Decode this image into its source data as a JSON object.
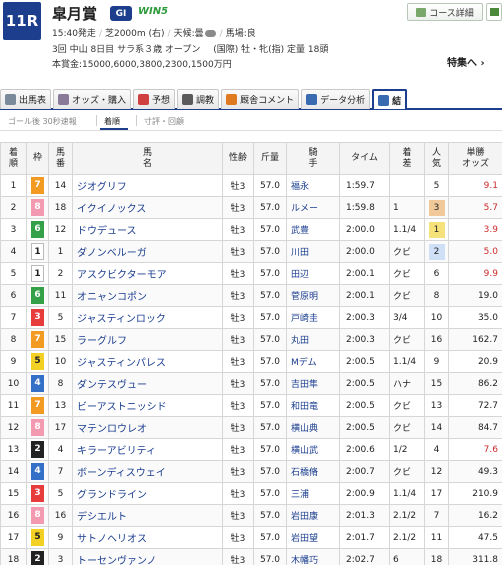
{
  "header": {
    "race_no": "11R",
    "race_name": "皐月賞",
    "grade": "GI",
    "win5": "WIN5",
    "start_time": "15:40発走",
    "course": "芝2000m (右)",
    "weather_label": "天候:曇",
    "track_label": "馬場:良",
    "meeting": "3回 中山 8日目",
    "class": "サラ系３歳 オープン",
    "conditions": "(国際) 牡・牝(指) 定量 18頭",
    "prize": "本賞金:15000,6000,3800,2300,1500万円",
    "course_button": "コース詳細",
    "special": "特集へ ›"
  },
  "tabs": [
    {
      "label": "出馬表",
      "icon": "table-icon",
      "color": "#7a8a9a"
    },
    {
      "label": "オッズ・購入",
      "icon": "ticket-icon",
      "color": "#8a7a9a"
    },
    {
      "label": "予想",
      "icon": "target-icon",
      "color": "#d04040"
    },
    {
      "label": "調教",
      "icon": "stopwatch-icon",
      "color": "#5a5a5a"
    },
    {
      "label": "厩舎コメント",
      "icon": "stable-icon",
      "color": "#e07a20"
    },
    {
      "label": "データ分析",
      "icon": "chart-icon",
      "color": "#3a6ab0"
    },
    {
      "label": "結",
      "icon": "result-icon",
      "color": "#3a6ab0"
    }
  ],
  "subtabs": {
    "first": "ゴール後 30秒速報",
    "active": "着順",
    "third": "寸評・回顧"
  },
  "columns": [
    "着順",
    "枠",
    "馬番",
    "馬名",
    "性齢",
    "斤量",
    "騎手",
    "タイム",
    "着差",
    "人気",
    "単勝オッズ"
  ],
  "rows": [
    {
      "pos": "1",
      "waku": "7",
      "uma": "14",
      "name": "ジオグリフ",
      "sex": "牡3",
      "kin": "57.0",
      "jockey": "福永",
      "time": "1:59.7",
      "margin": "",
      "pop": "5",
      "odds": "9.1"
    },
    {
      "pos": "2",
      "waku": "8",
      "uma": "18",
      "name": "イクイノックス",
      "sex": "牡3",
      "kin": "57.0",
      "jockey": "ルメー",
      "time": "1:59.8",
      "margin": "1",
      "pop": "3",
      "odds": "5.7"
    },
    {
      "pos": "3",
      "waku": "6",
      "uma": "12",
      "name": "ドウデュース",
      "sex": "牡3",
      "kin": "57.0",
      "jockey": "武豊",
      "time": "2:00.0",
      "margin": "1.1/4",
      "pop": "1",
      "odds": "3.9"
    },
    {
      "pos": "4",
      "waku": "1",
      "uma": "1",
      "name": "ダノンベルーガ",
      "sex": "牡3",
      "kin": "57.0",
      "jockey": "川田",
      "time": "2:00.0",
      "margin": "クビ",
      "pop": "2",
      "odds": "5.0"
    },
    {
      "pos": "5",
      "waku": "1",
      "uma": "2",
      "name": "アスクビクターモア",
      "sex": "牡3",
      "kin": "57.0",
      "jockey": "田辺",
      "time": "2:00.1",
      "margin": "クビ",
      "pop": "6",
      "odds": "9.9"
    },
    {
      "pos": "6",
      "waku": "6",
      "uma": "11",
      "name": "オニャンコポン",
      "sex": "牡3",
      "kin": "57.0",
      "jockey": "菅原明",
      "time": "2:00.1",
      "margin": "クビ",
      "pop": "8",
      "odds": "19.0"
    },
    {
      "pos": "7",
      "waku": "3",
      "uma": "5",
      "name": "ジャスティンロック",
      "sex": "牡3",
      "kin": "57.0",
      "jockey": "戸崎圭",
      "time": "2:00.3",
      "margin": "3/4",
      "pop": "10",
      "odds": "35.0"
    },
    {
      "pos": "8",
      "waku": "7",
      "uma": "15",
      "name": "ラーグルフ",
      "sex": "牡3",
      "kin": "57.0",
      "jockey": "丸田",
      "time": "2:00.3",
      "margin": "クビ",
      "pop": "16",
      "odds": "162.7"
    },
    {
      "pos": "9",
      "waku": "5",
      "uma": "10",
      "name": "ジャスティンパレス",
      "sex": "牡3",
      "kin": "57.0",
      "jockey": "Mデム",
      "time": "2:00.5",
      "margin": "1.1/4",
      "pop": "9",
      "odds": "20.9"
    },
    {
      "pos": "10",
      "waku": "4",
      "uma": "8",
      "name": "ダンテスヴュー",
      "sex": "牡3",
      "kin": "57.0",
      "jockey": "吉田隼",
      "time": "2:00.5",
      "margin": "ハナ",
      "pop": "15",
      "odds": "86.2"
    },
    {
      "pos": "11",
      "waku": "7",
      "uma": "13",
      "name": "ビーアストニッシド",
      "sex": "牡3",
      "kin": "57.0",
      "jockey": "和田竜",
      "time": "2:00.5",
      "margin": "クビ",
      "pop": "13",
      "odds": "72.7"
    },
    {
      "pos": "12",
      "waku": "8",
      "uma": "17",
      "name": "マテンロウレオ",
      "sex": "牡3",
      "kin": "57.0",
      "jockey": "横山典",
      "time": "2:00.5",
      "margin": "クビ",
      "pop": "14",
      "odds": "84.7"
    },
    {
      "pos": "13",
      "waku": "2",
      "uma": "4",
      "name": "キラーアビリティ",
      "sex": "牡3",
      "kin": "57.0",
      "jockey": "横山武",
      "time": "2:00.6",
      "margin": "1/2",
      "pop": "4",
      "odds": "7.6"
    },
    {
      "pos": "14",
      "waku": "4",
      "uma": "7",
      "name": "ボーンディスウェイ",
      "sex": "牡3",
      "kin": "57.0",
      "jockey": "石橋脩",
      "time": "2:00.7",
      "margin": "クビ",
      "pop": "12",
      "odds": "49.3"
    },
    {
      "pos": "15",
      "waku": "3",
      "uma": "5",
      "name": "グランドライン",
      "sex": "牡3",
      "kin": "57.0",
      "jockey": "三浦",
      "time": "2:00.9",
      "margin": "1.1/4",
      "pop": "17",
      "odds": "210.9"
    },
    {
      "pos": "16",
      "waku": "8",
      "uma": "16",
      "name": "デシエルト",
      "sex": "牡3",
      "kin": "57.0",
      "jockey": "岩田康",
      "time": "2:01.3",
      "margin": "2.1/2",
      "pop": "7",
      "odds": "16.2"
    },
    {
      "pos": "17",
      "waku": "5",
      "uma": "9",
      "name": "サトノヘリオス",
      "sex": "牡3",
      "kin": "57.0",
      "jockey": "岩田望",
      "time": "2:01.7",
      "margin": "2.1/2",
      "pop": "11",
      "odds": "47.5"
    },
    {
      "pos": "18",
      "waku": "2",
      "uma": "3",
      "name": "トーセンヴァンノ",
      "sex": "牡3",
      "kin": "57.0",
      "jockey": "木幡巧",
      "time": "2:02.7",
      "margin": "6",
      "pop": "18",
      "odds": "311.8"
    }
  ],
  "colors": {
    "accent": "#1c3e8c",
    "win5_green": "#2d9a3a",
    "odds_red": "#cc2a2a",
    "pop1_bg": "#f6e27a",
    "pop2_bg": "#cfe0f6",
    "pop3_bg": "#f0c89a",
    "waku": {
      "1": {
        "bg": "#ffffff",
        "fg": "#222222",
        "border": "#bbbbbb"
      },
      "2": {
        "bg": "#222222",
        "fg": "#ffffff"
      },
      "3": {
        "bg": "#e63c3c",
        "fg": "#ffffff"
      },
      "4": {
        "bg": "#3470c8",
        "fg": "#ffffff"
      },
      "5": {
        "bg": "#f2d024",
        "fg": "#222222"
      },
      "6": {
        "bg": "#34a048",
        "fg": "#ffffff"
      },
      "7": {
        "bg": "#f39a22",
        "fg": "#ffffff"
      },
      "8": {
        "bg": "#f49ab0",
        "fg": "#ffffff"
      }
    }
  }
}
